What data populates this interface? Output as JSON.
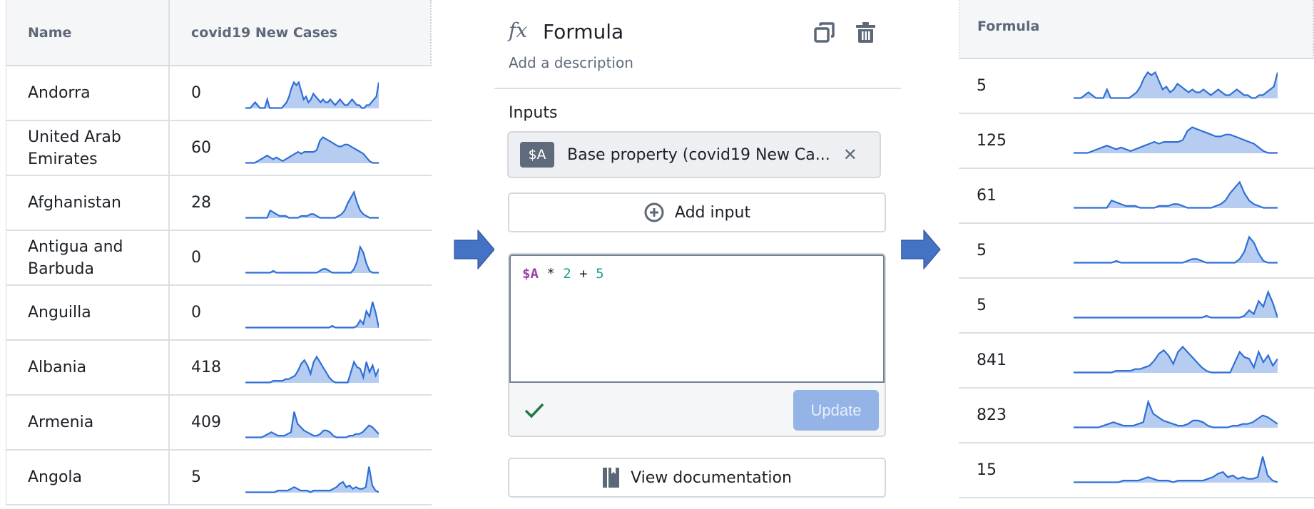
{
  "left_table": {
    "columns": [
      "Name",
      "covid19 New Cases"
    ],
    "rows": [
      {
        "name": "Andorra",
        "value": "0",
        "spark": "andorra"
      },
      {
        "name": "United Arab Emirates",
        "value": "60",
        "spark": "uae"
      },
      {
        "name": "Afghanistan",
        "value": "28",
        "spark": "afghanistan"
      },
      {
        "name": "Antigua and Barbuda",
        "value": "0",
        "spark": "antigua"
      },
      {
        "name": "Anguilla",
        "value": "0",
        "spark": "anguilla"
      },
      {
        "name": "Albania",
        "value": "418",
        "spark": "albania"
      },
      {
        "name": "Armenia",
        "value": "409",
        "spark": "armenia"
      },
      {
        "name": "Angola",
        "value": "5",
        "spark": "angola"
      }
    ]
  },
  "formula_panel": {
    "icon": "fx-icon",
    "title": "Formula",
    "description_placeholder": "Add a description",
    "actions": [
      "duplicate-icon",
      "trash-icon"
    ],
    "inputs_label": "Inputs",
    "inputs": [
      {
        "badge": "$A",
        "label": "Base property (covid19 New Ca..."
      }
    ],
    "add_input_label": "Add input",
    "expression": {
      "var": "$A",
      "op1": "*",
      "num1": "2",
      "op2": "+",
      "num2": "5"
    },
    "status": "valid",
    "update_label": "Update",
    "docs_label": "View documentation"
  },
  "right_table": {
    "columns": [
      "Formula"
    ],
    "rows": [
      {
        "value": "5",
        "spark": "andorra"
      },
      {
        "value": "125",
        "spark": "uae"
      },
      {
        "value": "61",
        "spark": "afghanistan"
      },
      {
        "value": "5",
        "spark": "antigua"
      },
      {
        "value": "5",
        "spark": "anguilla"
      },
      {
        "value": "841",
        "spark": "albania"
      },
      {
        "value": "823",
        "spark": "armenia"
      },
      {
        "value": "15",
        "spark": "angola"
      }
    ]
  },
  "colors": {
    "sparkline": "#2f6fd6",
    "arrow": "#4472c4",
    "badge": "#5f6b7c",
    "var_token": "#9c3fa8",
    "num_token": "#1a9e8f",
    "update_button": "#94b3e6",
    "valid_check": "#1f7a45"
  },
  "sparklines": {
    "andorra": [
      0,
      0,
      0,
      1,
      2,
      1,
      0,
      0,
      0,
      3,
      0,
      0,
      0,
      0,
      0,
      0,
      1,
      2,
      4,
      7,
      9,
      8,
      9,
      6,
      3,
      4,
      2,
      3,
      5,
      4,
      3,
      2,
      3,
      2,
      2,
      3,
      2,
      1,
      2,
      3,
      2,
      1,
      1,
      2,
      3,
      2,
      1,
      1,
      0,
      0,
      1,
      1,
      2,
      3,
      4,
      9
    ],
    "uae": [
      0,
      0,
      0,
      0,
      1,
      2,
      3,
      4,
      3,
      2,
      3,
      2,
      1,
      2,
      3,
      4,
      5,
      6,
      5,
      6,
      6,
      6,
      6,
      7,
      12,
      14,
      13,
      12,
      11,
      10,
      9,
      9,
      10,
      10,
      9,
      8,
      7,
      6,
      5,
      3,
      1,
      0,
      0,
      0
    ],
    "afghanistan": [
      0,
      0,
      0,
      0,
      0,
      0,
      0,
      0,
      4,
      3,
      2,
      1,
      1,
      1,
      0,
      0,
      0,
      0,
      1,
      1,
      1,
      2,
      2,
      1,
      0,
      0,
      0,
      0,
      0,
      0,
      1,
      2,
      4,
      8,
      11,
      14,
      8,
      4,
      2,
      1,
      0,
      0,
      0,
      0
    ],
    "antigua": [
      0,
      0,
      0,
      0,
      0,
      0,
      0,
      0,
      0,
      1,
      0,
      0,
      0,
      0,
      0,
      0,
      0,
      0,
      0,
      0,
      0,
      0,
      0,
      0,
      1,
      2,
      2,
      1,
      0,
      0,
      0,
      0,
      0,
      0,
      0,
      2,
      6,
      14,
      11,
      5,
      1,
      0,
      0,
      0
    ],
    "anguilla": [
      0,
      0,
      0,
      0,
      0,
      0,
      0,
      0,
      0,
      0,
      0,
      0,
      0,
      0,
      0,
      0,
      0,
      0,
      0,
      0,
      0,
      0,
      0,
      0,
      0,
      0,
      0,
      0,
      1,
      0,
      0,
      0,
      0,
      0,
      0,
      0,
      1,
      4,
      2,
      9,
      6,
      14,
      8,
      0
    ],
    "albania": [
      0,
      0,
      0,
      0,
      0,
      0,
      0,
      0,
      0,
      1,
      1,
      1,
      1,
      2,
      2,
      3,
      4,
      7,
      11,
      13,
      10,
      5,
      12,
      15,
      12,
      9,
      6,
      3,
      1,
      0,
      0,
      0,
      0,
      0,
      6,
      12,
      9,
      8,
      3,
      12,
      6,
      10,
      4,
      8
    ],
    "armenia": [
      0,
      0,
      0,
      0,
      0,
      0,
      1,
      2,
      3,
      2,
      1,
      1,
      1,
      2,
      3,
      15,
      8,
      6,
      4,
      3,
      2,
      1,
      1,
      2,
      4,
      4,
      3,
      1,
      0,
      0,
      0,
      0,
      1,
      1,
      2,
      2,
      3,
      5,
      7,
      6,
      4,
      2
    ],
    "angola": [
      0,
      0,
      0,
      0,
      0,
      0,
      0,
      0,
      0,
      0,
      1,
      1,
      1,
      1,
      2,
      3,
      2,
      1,
      1,
      1,
      0,
      1,
      1,
      1,
      1,
      1,
      1,
      2,
      3,
      5,
      6,
      3,
      4,
      2,
      3,
      2,
      2,
      3,
      15,
      4,
      1,
      0
    ]
  }
}
